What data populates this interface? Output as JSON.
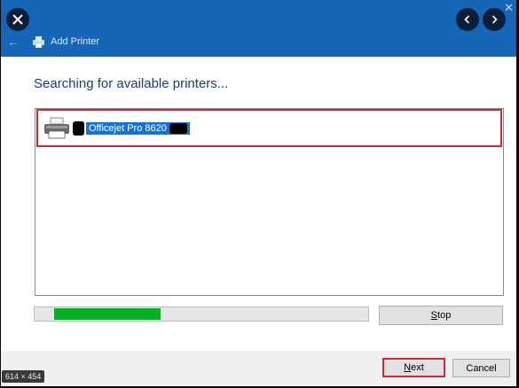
{
  "window": {
    "title": "Add Printer",
    "close_icon": "close-icon",
    "back_icon": "back-arrow-icon",
    "forward_icon": "forward-arrow-icon"
  },
  "content": {
    "heading": "Searching for available printers..."
  },
  "printer_list": {
    "items": [
      {
        "label": "Officejet Pro 8620",
        "icon": "printer-icon",
        "selected": true
      }
    ]
  },
  "progress": {
    "fraction": 0.32,
    "color": "#06b025"
  },
  "buttons": {
    "stop": "Stop",
    "next": "Next",
    "cancel": "Cancel"
  },
  "image_badge": "614 × 454",
  "colors": {
    "titlebar": "#1666b8",
    "heading": "#1e3b73",
    "selection": "#1473d6",
    "highlight_border": "#cc2a36"
  }
}
